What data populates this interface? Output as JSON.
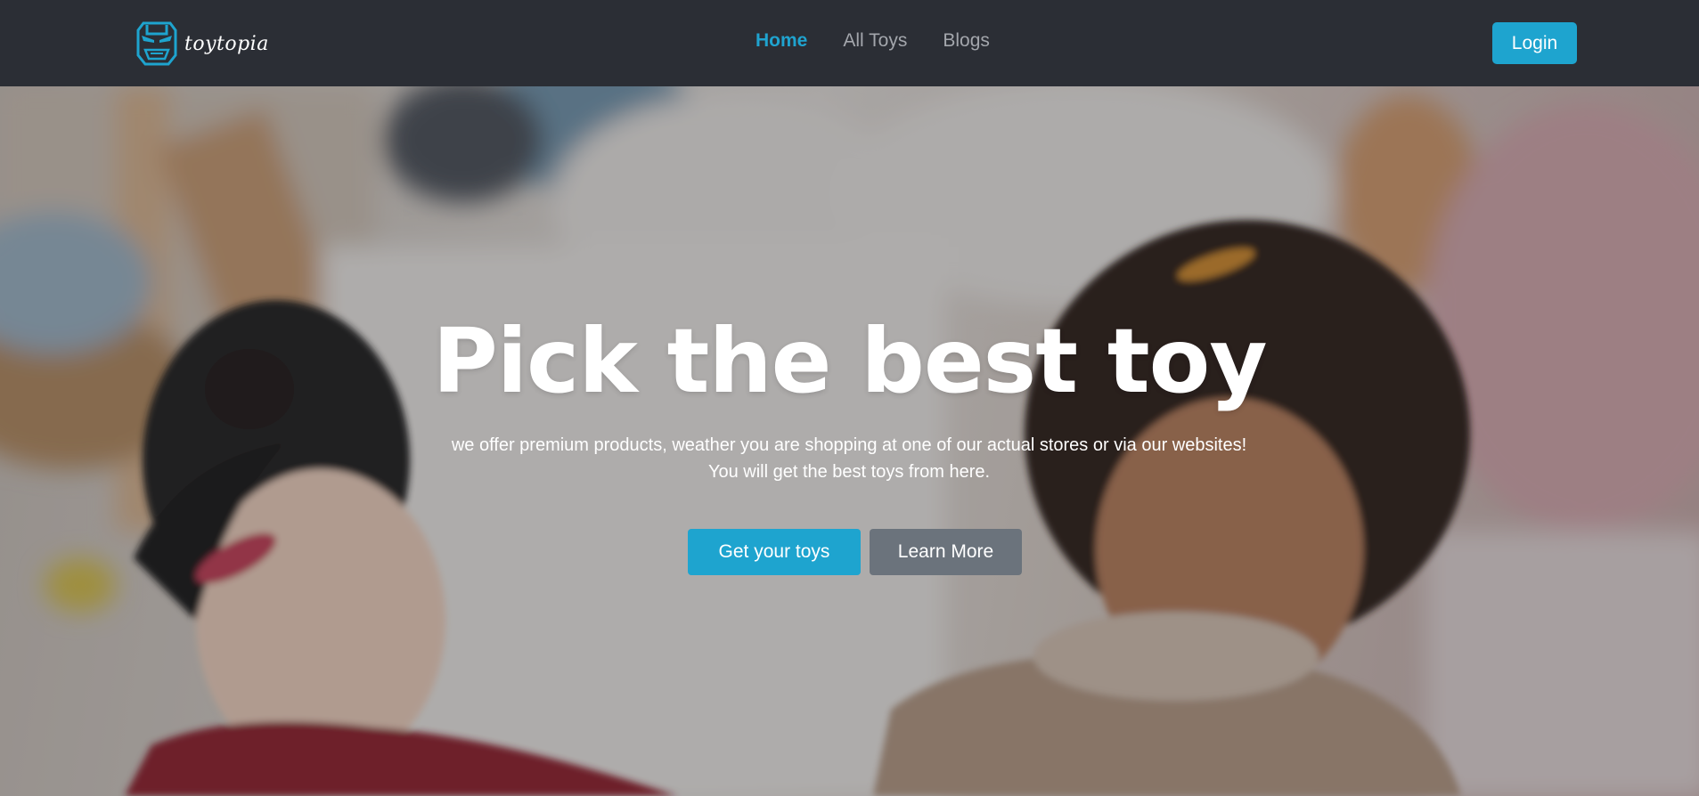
{
  "brand": {
    "name": "toytopia",
    "icon": "iron-mask-icon",
    "accent_color": "#1ea4cf"
  },
  "nav": {
    "links": [
      {
        "label": "Home",
        "active": true
      },
      {
        "label": "All Toys",
        "active": false
      },
      {
        "label": "Blogs",
        "active": false
      }
    ],
    "login_label": "Login"
  },
  "hero": {
    "title": "Pick the best toy",
    "subtitle_line1": "we offer premium products, weather you are shopping at one of our actual stores or via our websites!",
    "subtitle_line2": "You will get the best toys from here.",
    "primary_cta": "Get your toys",
    "secondary_cta": "Learn More",
    "background": "photo of two young girls playing with toys in a bedroom"
  },
  "colors": {
    "navbar_bg": "#2b2e35",
    "nav_active": "#1fa3cf",
    "nav_inactive": "#a3a6ac",
    "secondary_button": "#6b737c"
  }
}
